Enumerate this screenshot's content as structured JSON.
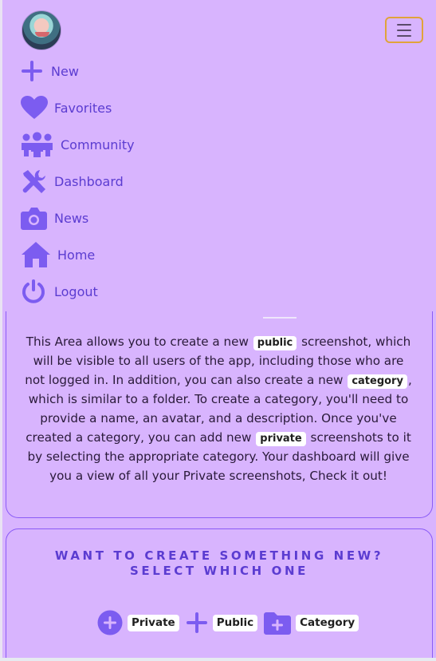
{
  "nav": {
    "toggle_icon": "hamburger-icon",
    "items": [
      {
        "label": "New",
        "icon": "plus-icon"
      },
      {
        "label": "Favorites",
        "icon": "heart-icon"
      },
      {
        "label": "Community",
        "icon": "people-icon"
      },
      {
        "label": "Dashboard",
        "icon": "tools-icon"
      },
      {
        "label": "News",
        "icon": "camera-icon"
      },
      {
        "label": "Home",
        "icon": "home-icon"
      },
      {
        "label": "Logout",
        "icon": "power-icon"
      }
    ]
  },
  "info": {
    "t1": "This Area allows you to create a new",
    "k1": "public",
    "t2": "screenshot, which will be visible to all users of the app, including those who are not logged in. In addition, you can also create a new",
    "k2": "category",
    "t3": ", which is similar to a folder. To create a category, you'll need to provide a name, an avatar, and a description. Once you've created a category, you can add new",
    "k3": "private",
    "t4": "screenshots to it by selecting the appropriate category. Your dashboard will give you a view of all your Private screenshots, Check it out!"
  },
  "create": {
    "title": "WANT TO CREATE SOMETHING NEW? SELECT WHICH ONE",
    "options": [
      {
        "label": "Private",
        "icon": "plus-circle-icon"
      },
      {
        "label": "Public",
        "icon": "plus-icon"
      },
      {
        "label": "Category",
        "icon": "folder-plus-icon"
      }
    ]
  },
  "colors": {
    "background": "#d8b4fe",
    "accent": "#5b3cd1",
    "icon": "#7c5cf0",
    "toggler_border": "#e0a33a",
    "card_border": "#8b5cf6"
  }
}
